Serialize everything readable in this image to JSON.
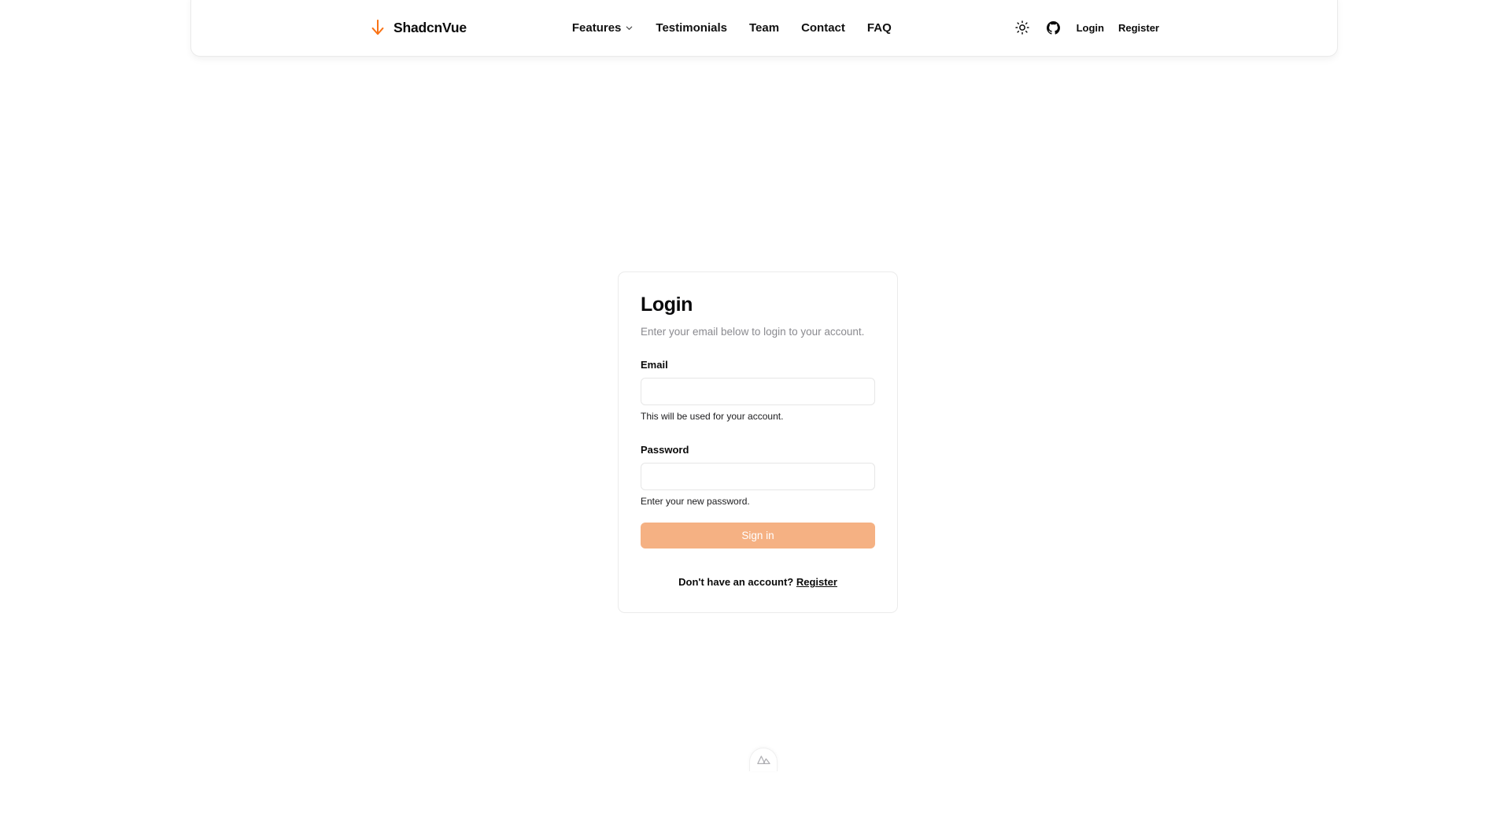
{
  "navbar": {
    "brand": {
      "icon": "arrow-down-icon",
      "name": "ShadcnVue"
    },
    "links": [
      {
        "label": "Features",
        "has_chevron": true,
        "icon": "chevron-down-icon"
      },
      {
        "label": "Testimonials",
        "has_chevron": false
      },
      {
        "label": "Team",
        "has_chevron": false
      },
      {
        "label": "Contact",
        "has_chevron": false
      },
      {
        "label": "FAQ",
        "has_chevron": false
      }
    ],
    "actions": {
      "theme_toggle_icon": "sun-icon",
      "github_icon": "github-icon",
      "login_label": "Login",
      "register_label": "Register"
    }
  },
  "login_card": {
    "title": "Login",
    "description": "Enter your email below to login to your account.",
    "email": {
      "label": "Email",
      "value": "",
      "placeholder": "",
      "hint": "This will be used for your account."
    },
    "password": {
      "label": "Password",
      "value": "",
      "placeholder": "",
      "hint": "Enter your new password."
    },
    "submit_label": "Sign in",
    "footer_text": "Don't have an account?",
    "footer_link": "Register"
  },
  "devtools": {
    "icon": "nuxt-mountain-icon"
  },
  "colors": {
    "accent": "#f97316",
    "button": "#f5b183",
    "page_background": "#ffffff",
    "border": "#ebebeb",
    "muted_text": "#8a8a8f"
  }
}
